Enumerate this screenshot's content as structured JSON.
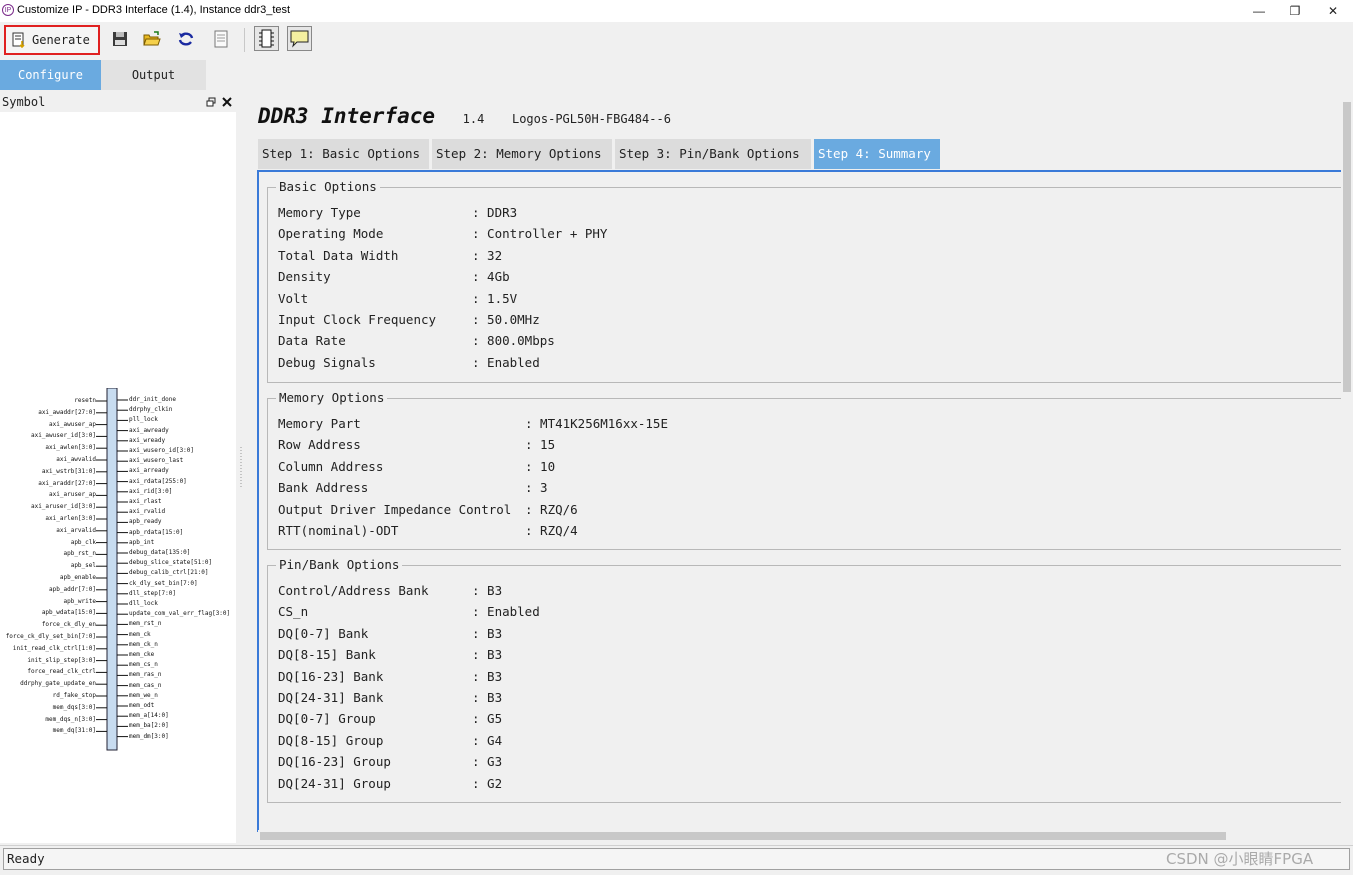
{
  "window": {
    "title": "Customize IP - DDR3 Interface (1.4), Instance ddr3_test",
    "app_icon": "IP",
    "controls": [
      "minimize-icon",
      "restore-icon",
      "close-icon"
    ]
  },
  "toolbar": {
    "generate_label": "Generate",
    "icons": [
      "save-icon",
      "open-folder-icon",
      "refresh-icon",
      "document-icon",
      "chip-icon",
      "comment-icon"
    ]
  },
  "top_tabs": [
    {
      "label": "Configure",
      "active": true
    },
    {
      "label": "Output",
      "active": false
    }
  ],
  "symbol_panel": {
    "title": "Symbol",
    "left_ports": [
      "resetn",
      "axi_awaddr[27:0]",
      "axi_awuser_ap",
      "axi_awuser_id[3:0]",
      "axi_awlen[3:0]",
      "axi_awvalid",
      "axi_wstrb[31:0]",
      "axi_araddr[27:0]",
      "axi_aruser_ap",
      "axi_aruser_id[3:0]",
      "axi_arlen[3:0]",
      "axi_arvalid",
      "apb_clk",
      "apb_rst_n",
      "apb_sel",
      "apb_enable",
      "apb_addr[7:0]",
      "apb_write",
      "apb_wdata[15:0]",
      "force_ck_dly_en",
      "force_ck_dly_set_bin[7:0]",
      "init_read_clk_ctrl[1:0]",
      "init_slip_step[3:0]",
      "force_read_clk_ctrl",
      "ddrphy_gate_update_en",
      "rd_fake_stop",
      "mem_dqs[3:0]",
      "mem_dqs_n[3:0]",
      "mem_dq[31:0]"
    ],
    "right_ports": [
      "ddr_init_done",
      "ddrphy_clkin",
      "pll_lock",
      "axi_awready",
      "axi_wready",
      "axi_wusero_id[3:0]",
      "axi_wusero_last",
      "axi_arready",
      "axi_rdata[255:0]",
      "axi_rid[3:0]",
      "axi_rlast",
      "axi_rvalid",
      "apb_ready",
      "apb_rdata[15:0]",
      "apb_int",
      "debug_data[135:0]",
      "debug_slice_state[51:0]",
      "debug_calib_ctrl[21:0]",
      "ck_dly_set_bin[7:0]",
      "dll_step[7:0]",
      "dll_lock",
      "update_com_val_err_flag[3:0]",
      "mem_rst_n",
      "mem_ck",
      "mem_ck_n",
      "mem_cke",
      "mem_cs_n",
      "mem_ras_n",
      "mem_cas_n",
      "mem_we_n",
      "mem_odt",
      "mem_a[14:0]",
      "mem_ba[2:0]",
      "mem_dm[3:0]"
    ]
  },
  "ip": {
    "name": "DDR3 Interface",
    "version": "1.4",
    "device": "Logos-PGL50H-FBG484--6"
  },
  "steps": [
    {
      "label": "Step 1: Basic Options",
      "active": false
    },
    {
      "label": "Step 2: Memory Options",
      "active": false
    },
    {
      "label": "Step 3: Pin/Bank Options",
      "active": false
    },
    {
      "label": "Step 4: Summary",
      "active": true
    }
  ],
  "summary": {
    "basic": {
      "title": "Basic Options",
      "rows": [
        {
          "k": "Memory Type",
          "v": ": DDR3"
        },
        {
          "k": "Operating Mode",
          "v": ": Controller + PHY"
        },
        {
          "k": "Total Data Width",
          "v": ": 32"
        },
        {
          "k": "Density",
          "v": ": 4Gb"
        },
        {
          "k": "Volt",
          "v": ": 1.5V"
        },
        {
          "k": "Input Clock Frequency",
          "v": ": 50.0MHz"
        },
        {
          "k": "Data Rate",
          "v": ": 800.0Mbps"
        },
        {
          "k": "Debug Signals",
          "v": ": Enabled"
        }
      ]
    },
    "memory": {
      "title": "Memory Options",
      "rows": [
        {
          "k": "Memory Part",
          "v": ": MT41K256M16xx-15E"
        },
        {
          "k": "Row Address",
          "v": ": 15"
        },
        {
          "k": "Column Address",
          "v": ": 10"
        },
        {
          "k": "Bank Address",
          "v": ": 3"
        },
        {
          "k": "Output Driver Impedance Control",
          "v": ": RZQ/6"
        },
        {
          "k": "RTT(nominal)-ODT",
          "v": ": RZQ/4"
        }
      ]
    },
    "pinbank": {
      "title": "Pin/Bank Options",
      "rows": [
        {
          "k": "Control/Address Bank",
          "v": ": B3"
        },
        {
          "k": "CS_n",
          "v": ": Enabled"
        },
        {
          "k": "DQ[0-7] Bank",
          "v": ": B3"
        },
        {
          "k": "DQ[8-15] Bank",
          "v": ": B3"
        },
        {
          "k": "DQ[16-23] Bank",
          "v": ": B3"
        },
        {
          "k": "DQ[24-31] Bank",
          "v": ": B3"
        },
        {
          "k": "DQ[0-7] Group",
          "v": ": G5"
        },
        {
          "k": "DQ[8-15] Group",
          "v": ": G4"
        },
        {
          "k": "DQ[16-23] Group",
          "v": ": G3"
        },
        {
          "k": "DQ[24-31] Group",
          "v": ": G2"
        }
      ]
    }
  },
  "status": {
    "text": "Ready"
  },
  "watermark": "CSDN @小眼睛FPGA"
}
